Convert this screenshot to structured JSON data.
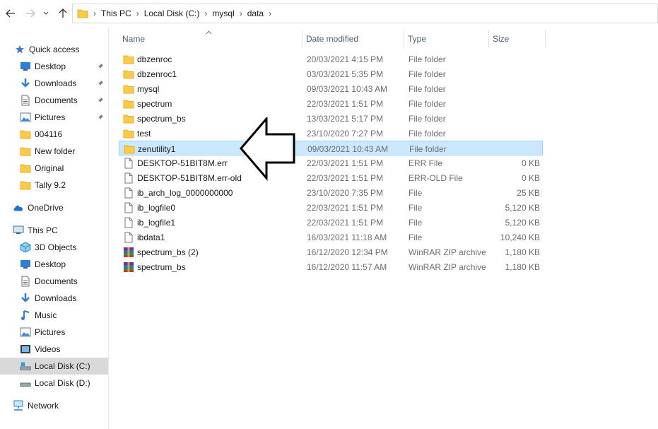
{
  "address": {
    "crumbs": [
      "This PC",
      "Local Disk (C:)",
      "mysql",
      "data"
    ]
  },
  "sidebar": {
    "items": [
      {
        "label": "Quick access",
        "icon": "star-icon",
        "pinned": false
      },
      {
        "label": "Desktop",
        "icon": "desktop-icon",
        "pinned": true
      },
      {
        "label": "Downloads",
        "icon": "downloads-icon",
        "pinned": true
      },
      {
        "label": "Documents",
        "icon": "documents-icon",
        "pinned": true
      },
      {
        "label": "Pictures",
        "icon": "pictures-icon",
        "pinned": true
      },
      {
        "label": "004116",
        "icon": "folder-icon",
        "pinned": false
      },
      {
        "label": "New folder",
        "icon": "folder-icon",
        "pinned": false
      },
      {
        "label": "Original",
        "icon": "folder-icon",
        "pinned": false
      },
      {
        "label": "Tally 9.2",
        "icon": "folder-icon",
        "pinned": false
      },
      {
        "label": "OneDrive",
        "icon": "onedrive-icon",
        "pinned": false
      },
      {
        "label": "This PC",
        "icon": "this-pc-icon",
        "pinned": false
      },
      {
        "label": "3D Objects",
        "icon": "3d-objects-icon",
        "pinned": false
      },
      {
        "label": "Desktop",
        "icon": "desktop-icon",
        "pinned": false
      },
      {
        "label": "Documents",
        "icon": "documents-icon",
        "pinned": false
      },
      {
        "label": "Downloads",
        "icon": "downloads-icon",
        "pinned": false
      },
      {
        "label": "Music",
        "icon": "music-icon",
        "pinned": false
      },
      {
        "label": "Pictures",
        "icon": "pictures-icon",
        "pinned": false
      },
      {
        "label": "Videos",
        "icon": "videos-icon",
        "pinned": false
      },
      {
        "label": "Local Disk (C:)",
        "icon": "drive-c-icon",
        "pinned": false,
        "selected": true
      },
      {
        "label": "Local Disk (D:)",
        "icon": "drive-icon",
        "pinned": false
      },
      {
        "label": "Network",
        "icon": "network-icon",
        "pinned": false
      }
    ]
  },
  "columns": {
    "name": "Name",
    "date": "Date modified",
    "type": "Type",
    "size": "Size"
  },
  "files": [
    {
      "name": "dbzenroc",
      "date": "20/03/2021 4:15 PM",
      "type": "File folder",
      "size": "",
      "icon": "folder-icon"
    },
    {
      "name": "dbzenroc1",
      "date": "03/03/2021 5:35 PM",
      "type": "File folder",
      "size": "",
      "icon": "folder-icon"
    },
    {
      "name": "mysql",
      "date": "09/03/2021 10:43 AM",
      "type": "File folder",
      "size": "",
      "icon": "folder-icon"
    },
    {
      "name": "spectrum",
      "date": "22/03/2021 1:51 PM",
      "type": "File folder",
      "size": "",
      "icon": "folder-icon"
    },
    {
      "name": "spectrum_bs",
      "date": "13/03/2021 5:17 PM",
      "type": "File folder",
      "size": "",
      "icon": "folder-icon"
    },
    {
      "name": "test",
      "date": "23/10/2020 7:27 PM",
      "type": "File folder",
      "size": "",
      "icon": "folder-icon"
    },
    {
      "name": "zenutility1",
      "date": "09/03/2021 10:43 AM",
      "type": "File folder",
      "size": "",
      "icon": "folder-icon",
      "selected": true
    },
    {
      "name": "DESKTOP-51BIT8M.err",
      "date": "22/03/2021 1:51 PM",
      "type": "ERR File",
      "size": "0 KB",
      "icon": "file-icon"
    },
    {
      "name": "DESKTOP-51BIT8M.err-old",
      "date": "22/03/2021 1:51 PM",
      "type": "ERR-OLD File",
      "size": "0 KB",
      "icon": "file-icon"
    },
    {
      "name": "ib_arch_log_0000000000",
      "date": "23/10/2020 7:35 PM",
      "type": "File",
      "size": "25 KB",
      "icon": "file-icon"
    },
    {
      "name": "ib_logfile0",
      "date": "22/03/2021 1:51 PM",
      "type": "File",
      "size": "5,120 KB",
      "icon": "file-icon"
    },
    {
      "name": "ib_logfile1",
      "date": "22/03/2021 1:51 PM",
      "type": "File",
      "size": "5,120 KB",
      "icon": "file-icon"
    },
    {
      "name": "ibdata1",
      "date": "16/03/2021 11:18 AM",
      "type": "File",
      "size": "10,240 KB",
      "icon": "file-icon"
    },
    {
      "name": "spectrum_bs (2)",
      "date": "16/12/2020 12:34 PM",
      "type": "WinRAR ZIP archive",
      "size": "1,180 KB",
      "icon": "winrar-icon"
    },
    {
      "name": "spectrum_bs",
      "date": "16/12/2020 11:57 AM",
      "type": "WinRAR ZIP archive",
      "size": "1,180 KB",
      "icon": "winrar-icon"
    }
  ],
  "colors": {
    "selection": "#cce8ff",
    "selection_border": "#99d1ff",
    "folder": "#ffcb45",
    "header_text": "#4c607a",
    "sidebar_selected": "#d9d9d9"
  }
}
